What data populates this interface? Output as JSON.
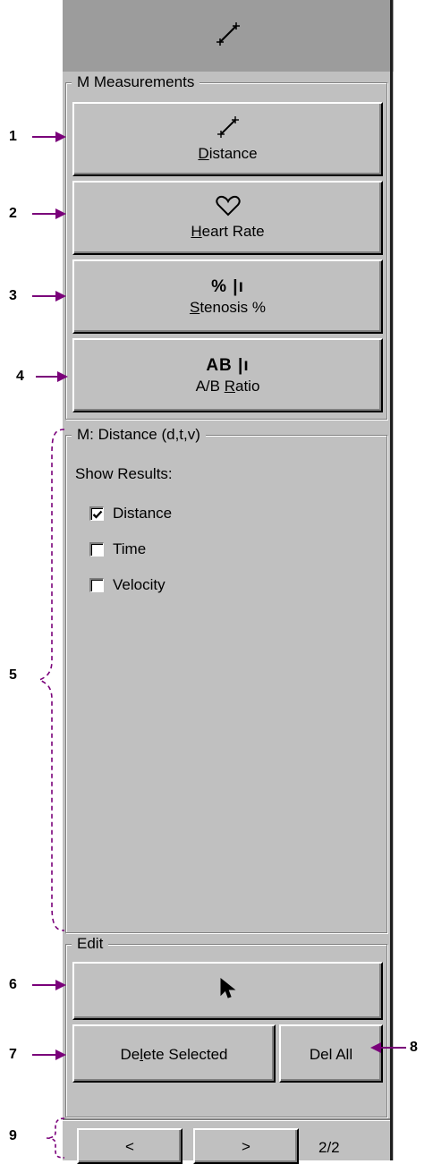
{
  "header": {
    "icon": "distance-caliper-icon"
  },
  "m_measurements": {
    "legend": "M Measurements",
    "buttons": [
      {
        "id": "distance",
        "icon": "caliper-icon",
        "label_pre": "",
        "label_ul": "D",
        "label_post": "istance"
      },
      {
        "id": "heart_rate",
        "icon": "heart-icon",
        "label_pre": "",
        "label_ul": "H",
        "label_post": "eart Rate"
      },
      {
        "id": "stenosis",
        "icon": "stenosis-icon",
        "glyph": "% |ı",
        "label_pre": "",
        "label_ul": "S",
        "label_post": "tenosis %"
      },
      {
        "id": "ab_ratio",
        "icon": "ab-ratio-icon",
        "glyph": "AB |ı",
        "label_pre": "A/B ",
        "label_ul": "R",
        "label_post": "atio"
      }
    ]
  },
  "m_distance": {
    "legend": "M: Distance (d,t,v)",
    "show_results_label": "Show Results:",
    "options": [
      {
        "label": "Distance",
        "checked": true
      },
      {
        "label": "Time",
        "checked": false
      },
      {
        "label": "Velocity",
        "checked": false
      }
    ]
  },
  "edit": {
    "legend": "Edit",
    "select_icon": "pointer-arrow-icon",
    "delete_selected_pre": "De",
    "delete_selected_ul": "l",
    "delete_selected_post": "ete Selected",
    "del_all": "Del All"
  },
  "pager": {
    "prev": "<",
    "next": ">",
    "page": "2/2"
  },
  "callouts": [
    "1",
    "2",
    "3",
    "4",
    "5",
    "6",
    "7",
    "8",
    "9"
  ],
  "colors": {
    "callout_arrow": "#7a007a",
    "panel": "#c0c0c0",
    "titlebar": "#9c9c9c"
  }
}
